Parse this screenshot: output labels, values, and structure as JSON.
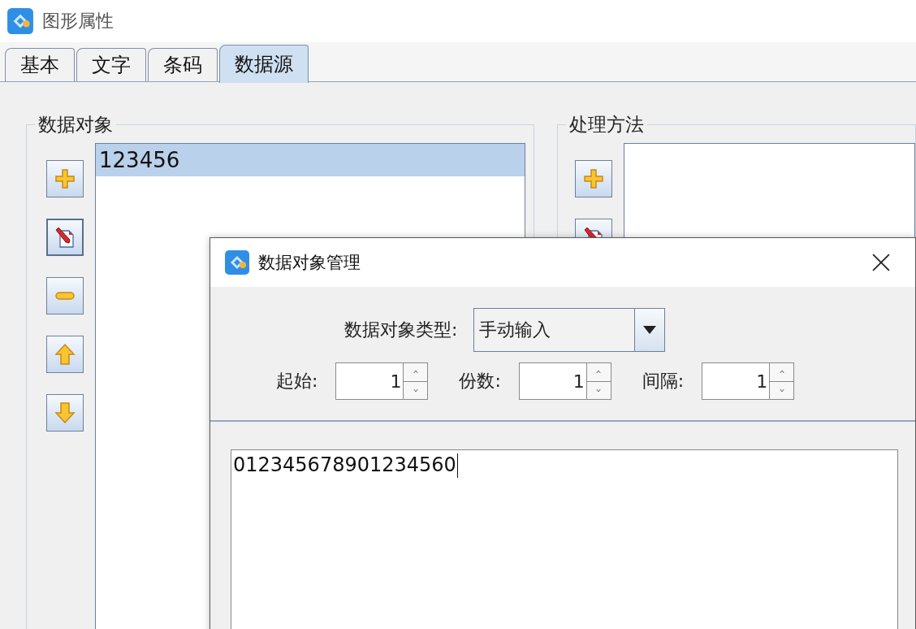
{
  "window": {
    "title": "图形属性"
  },
  "tabs": [
    {
      "label": "基本",
      "selected": false
    },
    {
      "label": "文字",
      "selected": false
    },
    {
      "label": "条码",
      "selected": false
    },
    {
      "label": "数据源",
      "selected": true
    }
  ],
  "data_objects": {
    "title": "数据对象",
    "items": [
      {
        "label": "123456",
        "selected": true
      }
    ]
  },
  "processing": {
    "title": "处理方法"
  },
  "dialog": {
    "title": "数据对象管理",
    "type_label": "数据对象类型:",
    "type_value": "手动输入",
    "spinners": [
      {
        "label": "起始:",
        "value": "1"
      },
      {
        "label": "份数:",
        "value": "1"
      },
      {
        "label": "间隔:",
        "value": "1"
      }
    ],
    "content": "012345678901234560"
  }
}
